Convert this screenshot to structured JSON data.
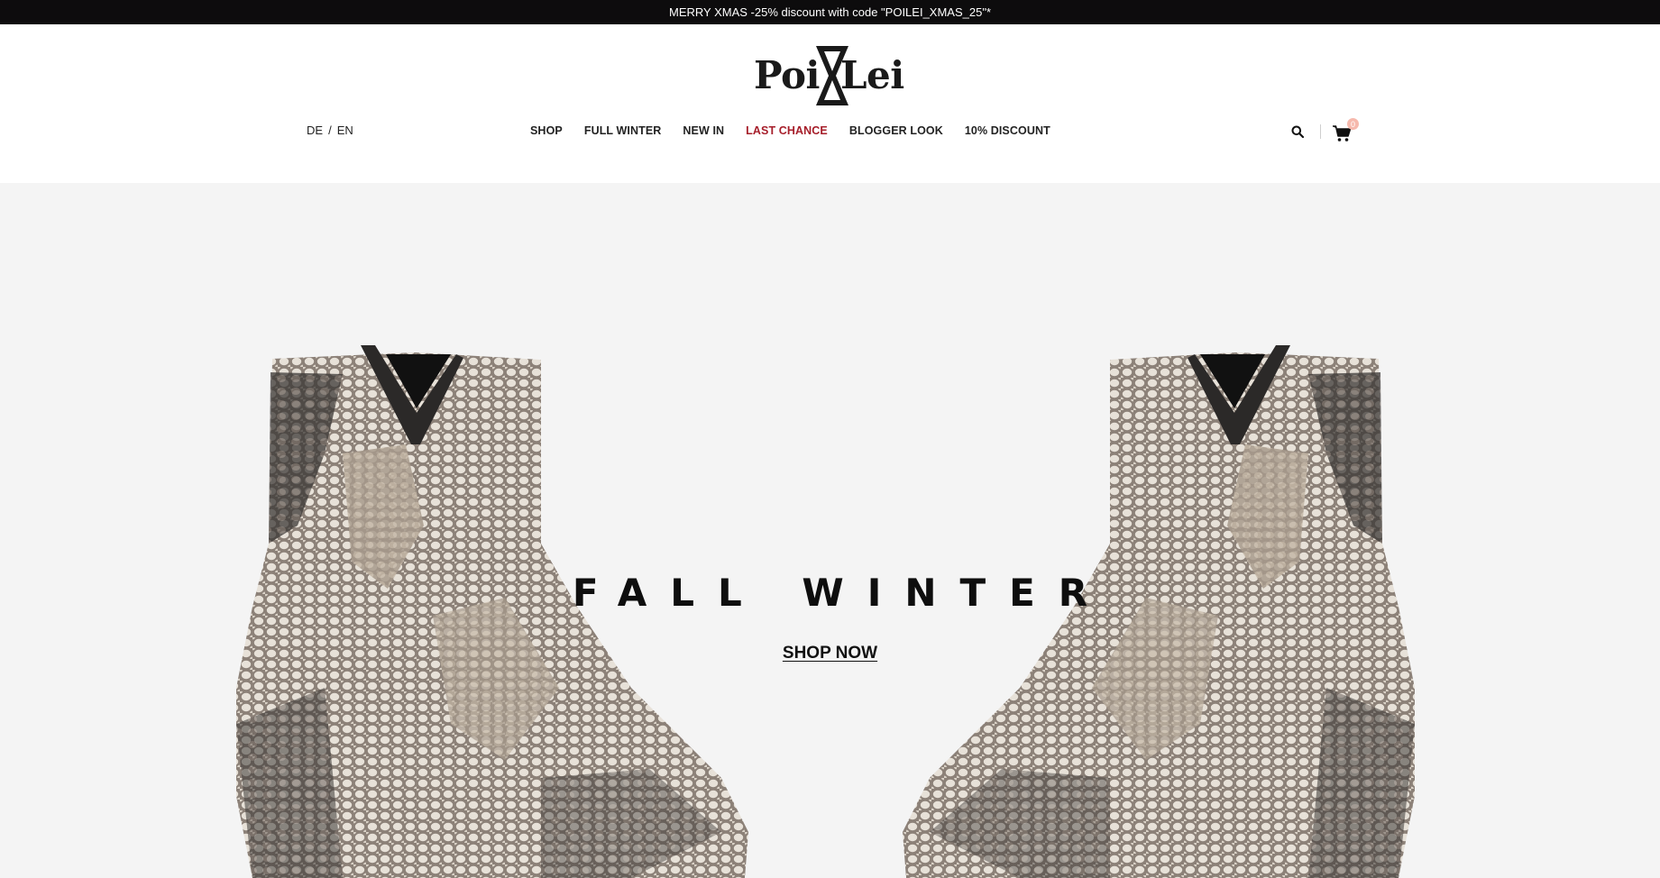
{
  "announcement": {
    "text": "MERRY XMAS -25% discount with code \"POILEI_XMAS_25\"*"
  },
  "brand": {
    "left": "Poi",
    "right": "Lei"
  },
  "language": {
    "de": "DE",
    "separator": "/",
    "en": "EN"
  },
  "nav": {
    "items": [
      {
        "label": "SHOP"
      },
      {
        "label": "FULL WINTER"
      },
      {
        "label": "NEW IN"
      },
      {
        "label": "LAST CHANCE"
      },
      {
        "label": "BLOGGER LOOK"
      },
      {
        "label": "10% DISCOUNT"
      }
    ]
  },
  "header_icons": {
    "search": "search-icon",
    "cart": "shopping-cart-icon",
    "cart_count": "0"
  },
  "hero": {
    "title": "FALL WINTER",
    "cta": "SHOP NOW"
  },
  "colors": {
    "topbar": "#0d0c0d",
    "highlight": "#a61e2a",
    "hero_bg": "#f4f4f4",
    "badge": "#f6b9ad"
  }
}
